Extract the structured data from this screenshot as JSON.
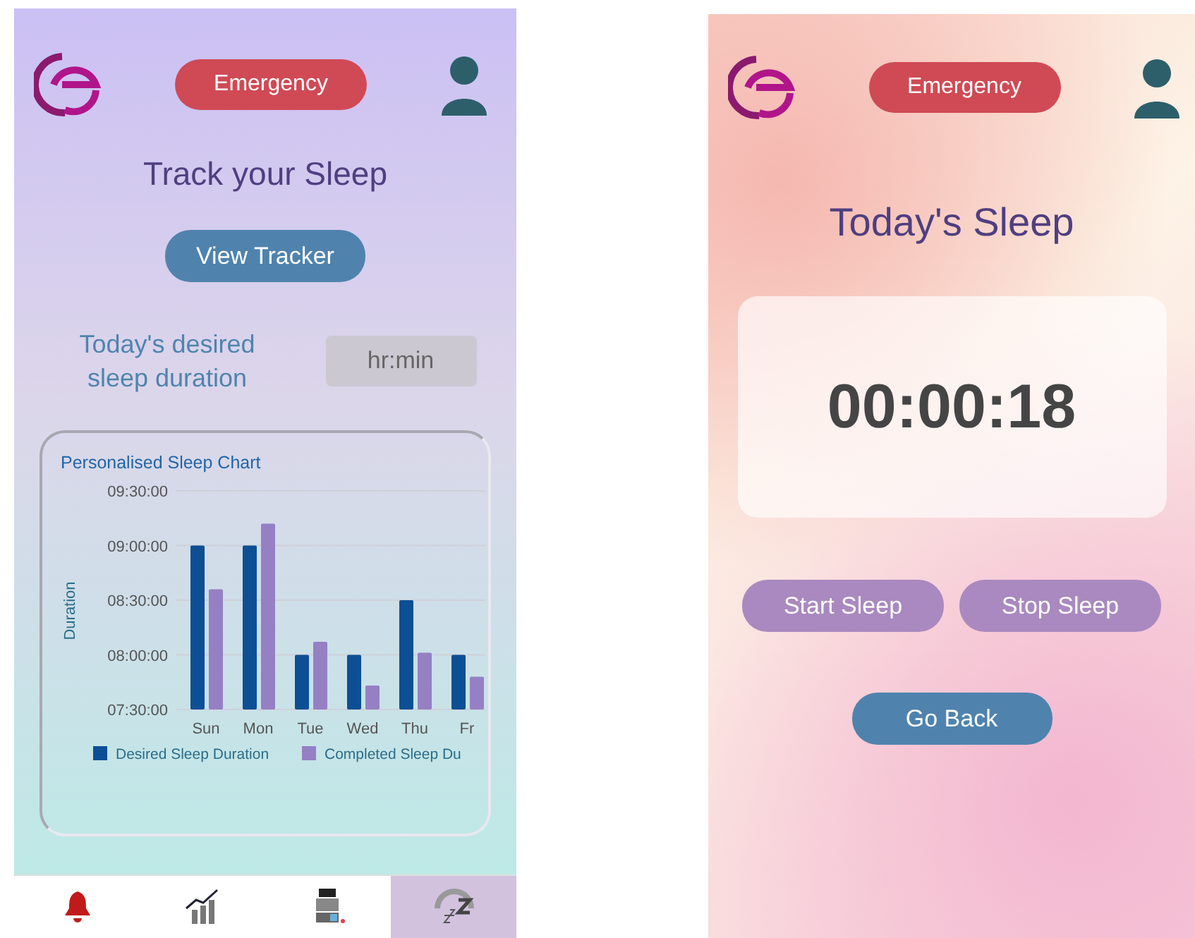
{
  "tracker_screen": {
    "emergency_button": "Emergency",
    "title": "Track your Sleep",
    "view_button": "View Tracker",
    "duration_label": "Today's desired sleep duration",
    "duration_field": {
      "placeholder": "hr:min"
    },
    "chart": {
      "chart_data": {
        "type": "bar",
        "title": "Personalised Sleep Chart",
        "ylabel": "Duration",
        "categories": [
          "Sun",
          "Mon",
          "Tue",
          "Wed",
          "Thu",
          "Fr"
        ],
        "series": [
          {
            "name": "Desired Sleep Duration",
            "color": "#0d4f94",
            "values": [
              9,
              9,
              8,
              8,
              8.5,
              8
            ]
          },
          {
            "name": "Completed Sleep Du",
            "color": "#9580c4",
            "values": [
              8.6,
              9.2,
              8.12,
              7.72,
              8.02,
              7.8
            ]
          }
        ],
        "grid": true,
        "legend": true,
        "ylim": [
          7.5,
          9.5
        ],
        "yticks": [
          {
            "value": 7.5,
            "label": "07:30:00"
          },
          {
            "value": 8,
            "label": "08:00:00"
          },
          {
            "value": 8.5,
            "label": "08:30:00"
          },
          {
            "value": 9,
            "label": "09:00:00"
          },
          {
            "value": 9.5,
            "label": "09:30:00"
          }
        ]
      }
    },
    "nav_tabs": [
      {
        "kind": "alerts",
        "selected": false
      },
      {
        "kind": "progress",
        "selected": false
      },
      {
        "kind": "medicine",
        "selected": false
      },
      {
        "kind": "sleep",
        "selected": true
      }
    ]
  },
  "sleep_screen": {
    "emergency_button": "Emergency",
    "title": "Today's Sleep",
    "timer": "00:00:18",
    "buttons": [
      "Start Sleep",
      "Stop Sleep"
    ],
    "back_button": "Go Back"
  }
}
